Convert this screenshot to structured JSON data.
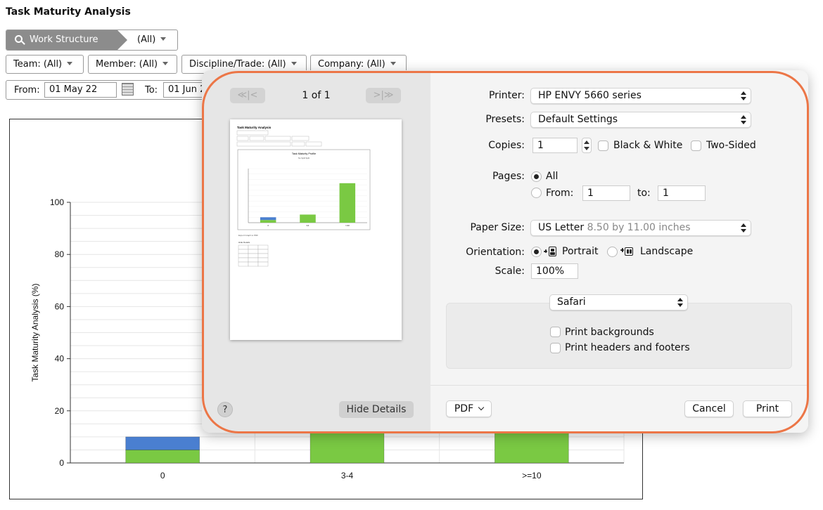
{
  "page": {
    "title": "Task Maturity Analysis",
    "work_structure_label": "Work Structure",
    "work_structure_value": "(All)",
    "filters": {
      "team": "Team: (All)",
      "member": "Member: (All)",
      "discipline": "Discipline/Trade: (All)",
      "company": "Company: (All)"
    },
    "from_label": "From:",
    "from_value": "01 May 22",
    "to_label": "To:",
    "to_value": "01 Jun 2"
  },
  "chart_data": {
    "type": "bar",
    "stacked": true,
    "categories": [
      "0",
      "3-4",
      ">=10"
    ],
    "series": [
      {
        "color": "#7ac943",
        "values": [
          5,
          null,
          null
        ]
      },
      {
        "color": "#4a7fd0",
        "values": [
          5,
          null,
          null
        ]
      }
    ],
    "title": "",
    "xlabel": "",
    "ylabel": "Task Maturity Analysis (%)",
    "ylim": [
      0,
      100
    ],
    "yticks": [
      0,
      20,
      40,
      60,
      80,
      100
    ],
    "grid": true
  },
  "dialog": {
    "nav_first": "≪|<",
    "nav_last": ">|≫",
    "page_count": "1 of 1",
    "help": "?",
    "hide_details": "Hide Details",
    "printer_label": "Printer:",
    "printer_value": "HP ENVY 5660 series",
    "presets_label": "Presets:",
    "presets_value": "Default Settings",
    "copies_label": "Copies:",
    "copies_value": "1",
    "black_white": "Black & White",
    "two_sided": "Two-Sided",
    "pages_label": "Pages:",
    "pages_all": "All",
    "pages_from": "From:",
    "pages_from_value": "1",
    "pages_to": "to:",
    "pages_to_value": "1",
    "paper_label": "Paper Size:",
    "paper_value": "US Letter",
    "paper_dims": "8.50 by 11.00 inches",
    "orientation_label": "Orientation:",
    "portrait": "Portrait",
    "landscape": "Landscape",
    "scale_label": "Scale:",
    "scale_value": "100%",
    "app_section": "Safari",
    "print_backgrounds": "Print backgrounds",
    "print_headers": "Print headers and footers",
    "pdf": "PDF",
    "cancel": "Cancel",
    "print": "Print"
  },
  "preview_thumbnail": {
    "page_title": "Task Maturity Analysis",
    "chart_title": "Task Maturity Profile",
    "legend": [
      "No Split",
      "Split"
    ],
    "bar_values": [
      10,
      15,
      73
    ],
    "categories": [
      "0",
      "3-4",
      ">=10"
    ],
    "export_link": "Export Graph to PDF",
    "hide_details": "Hide Details"
  },
  "colors": {
    "accent_highlight": "#ec7647",
    "bar_green": "#7ac943",
    "bar_blue": "#4a7fd0"
  }
}
